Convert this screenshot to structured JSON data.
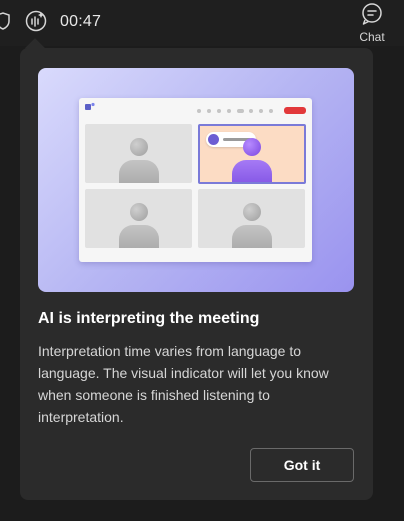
{
  "topbar": {
    "timer": "00:47",
    "chat_label": "Chat",
    "shield_icon": "shield-icon",
    "interpreter_icon": "ai-interpretation-icon",
    "chat_icon": "chat-bubble-icon"
  },
  "popup": {
    "title": "AI is interpreting the meeting",
    "description": "Interpretation time varies from language to language. The visual indicator will let you know when someone is finished listening to interpretation.",
    "button_label": "Got it"
  },
  "colors": {
    "popup_background": "#2b2b2b",
    "accent_purple": "#7b47e0",
    "end_call_red": "#e2383a",
    "illustration_gradient_start": "#d9dafc",
    "illustration_gradient_end": "#9a93ef"
  }
}
